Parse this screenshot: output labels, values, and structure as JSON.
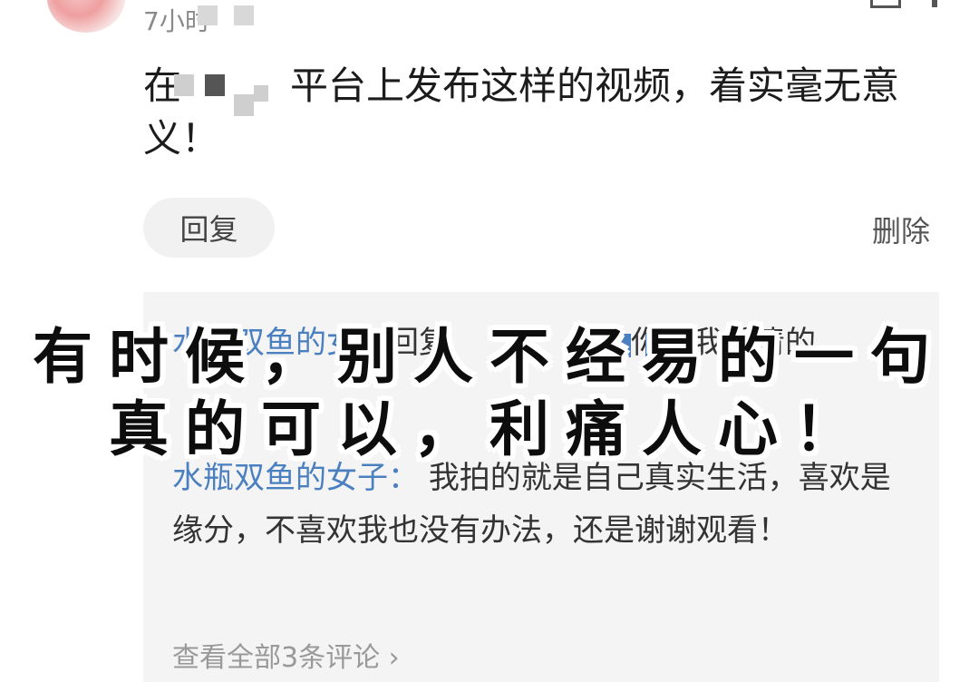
{
  "header": {
    "time_prefix": "7小时"
  },
  "comment": {
    "text_prefix": "在",
    "text_main": "平台上发布这样的视频，着实毫无意义！"
  },
  "actions": {
    "reply_label": "回复",
    "delete_label": "删除"
  },
  "replies": [
    {
      "author": "水瓶双鱼的女子",
      "action": "回复",
      "target": "",
      "text": "你好我看清的"
    },
    {
      "author": "水瓶双鱼的女子：",
      "text": "我拍的就是自己真实生活，喜欢是缘分，不喜欢我也没有办法，还是谢谢观看！"
    }
  ],
  "view_all": {
    "label": "查看全部3条评论",
    "chevron": "›"
  },
  "overlay": {
    "line1": "有时候，别人不经易的一句",
    "line2": "真的可以，利痛人心！"
  },
  "colors": {
    "author": "#4a7fc0",
    "reply_box_bg": "#f4f4f4"
  }
}
